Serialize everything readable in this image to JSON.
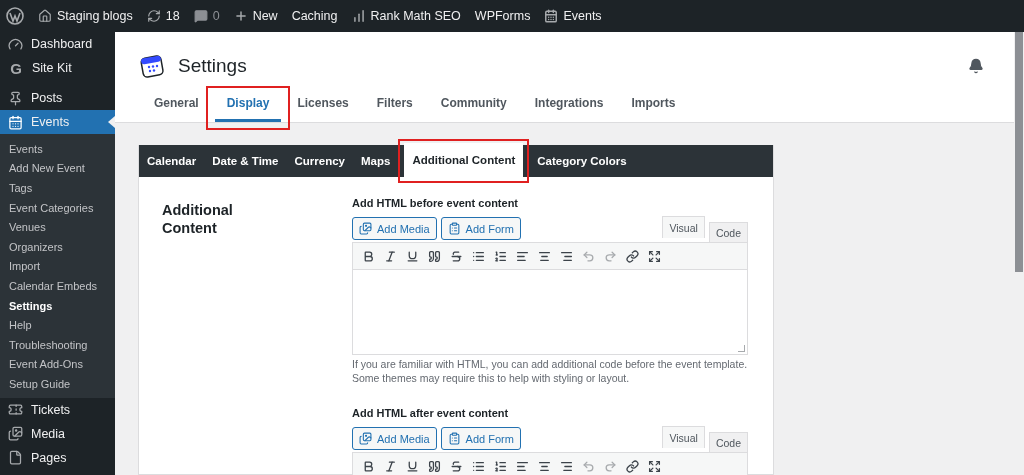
{
  "admin_bar": {
    "site": "Staging blogs",
    "updates": "18",
    "comments": "0",
    "items": [
      {
        "label": "New",
        "kind": "new"
      },
      {
        "label": "Caching",
        "kind": "plain"
      },
      {
        "label": "Rank Math SEO",
        "kind": "chart"
      },
      {
        "label": "WPForms",
        "kind": "plain"
      },
      {
        "label": "Events",
        "kind": "events"
      }
    ]
  },
  "sidebar": {
    "groups": [
      [
        {
          "label": "Dashboard",
          "kind": "gauge",
          "selected": false
        },
        {
          "label": "Site Kit",
          "kind": "glyph",
          "glyph": "G",
          "selected": false
        }
      ],
      [
        {
          "label": "Posts",
          "kind": "pin",
          "selected": false
        },
        {
          "label": "Events",
          "kind": "calendar",
          "selected": true,
          "children": [
            {
              "label": "Events",
              "selected": false
            },
            {
              "label": "Add New Event",
              "selected": false
            },
            {
              "label": "Tags",
              "selected": false
            },
            {
              "label": "Event Categories",
              "selected": false
            },
            {
              "label": "Venues",
              "selected": false
            },
            {
              "label": "Organizers",
              "selected": false
            },
            {
              "label": "Import",
              "selected": false
            },
            {
              "label": "Calendar Embeds",
              "selected": false
            },
            {
              "label": "Settings",
              "selected": true
            },
            {
              "label": "Help",
              "selected": false
            },
            {
              "label": "Troubleshooting",
              "selected": false
            },
            {
              "label": "Event Add-Ons",
              "selected": false
            },
            {
              "label": "Setup Guide",
              "selected": false
            }
          ]
        },
        {
          "label": "Tickets",
          "kind": "ticket",
          "selected": false
        },
        {
          "label": "Media",
          "kind": "media",
          "selected": false
        },
        {
          "label": "Pages",
          "kind": "page",
          "selected": false
        }
      ]
    ]
  },
  "header": {
    "title": "Settings",
    "tabs": [
      {
        "label": "General",
        "selected": false,
        "highlighted": false
      },
      {
        "label": "Display",
        "selected": true,
        "highlighted": true
      },
      {
        "label": "Licenses",
        "selected": false,
        "highlighted": false
      },
      {
        "label": "Filters",
        "selected": false,
        "highlighted": false
      },
      {
        "label": "Community",
        "selected": false,
        "highlighted": false
      },
      {
        "label": "Integrations",
        "selected": false,
        "highlighted": false
      },
      {
        "label": "Imports",
        "selected": false,
        "highlighted": false
      }
    ]
  },
  "panel": {
    "tabs": [
      {
        "label": "Calendar",
        "selected": false,
        "highlighted": false
      },
      {
        "label": "Date & Time",
        "selected": false,
        "highlighted": false
      },
      {
        "label": "Currency",
        "selected": false,
        "highlighted": false
      },
      {
        "label": "Maps",
        "selected": false,
        "highlighted": false
      },
      {
        "label": "Additional Content",
        "selected": true,
        "highlighted": true
      },
      {
        "label": "Category Colors",
        "selected": false,
        "highlighted": false
      }
    ],
    "section_title": "Additional Content",
    "editors": [
      {
        "label": "Add HTML before event content",
        "buttons": [
          {
            "label": "Add Media",
            "kind": "media"
          },
          {
            "label": "Add Form",
            "kind": "form"
          }
        ],
        "modes": [
          {
            "label": "Visual",
            "selected": false
          },
          {
            "label": "Code",
            "selected": true
          }
        ],
        "toolbar": [
          {
            "kind": "bold",
            "disabled": false
          },
          {
            "kind": "italic",
            "disabled": false
          },
          {
            "kind": "underline",
            "disabled": false
          },
          {
            "kind": "quote",
            "disabled": false
          },
          {
            "kind": "strike",
            "disabled": false
          },
          {
            "kind": "bullets",
            "disabled": false
          },
          {
            "kind": "numbers",
            "disabled": false
          },
          {
            "kind": "align-left",
            "disabled": false
          },
          {
            "kind": "align-center",
            "disabled": false
          },
          {
            "kind": "align-right",
            "disabled": false
          },
          {
            "kind": "undo",
            "disabled": true
          },
          {
            "kind": "redo",
            "disabled": true
          },
          {
            "kind": "link",
            "disabled": false
          },
          {
            "kind": "fullscreen",
            "disabled": false
          }
        ],
        "description": "If you are familiar with HTML, you can add additional code before the event template. Some themes may require this to help with styling or layout."
      },
      {
        "label": "Add HTML after event content",
        "buttons": [
          {
            "label": "Add Media",
            "kind": "media"
          },
          {
            "label": "Add Form",
            "kind": "form"
          }
        ],
        "modes": [
          {
            "label": "Visual",
            "selected": false
          },
          {
            "label": "Code",
            "selected": true
          }
        ],
        "toolbar": [
          {
            "kind": "bold",
            "disabled": false
          },
          {
            "kind": "italic",
            "disabled": false
          },
          {
            "kind": "underline",
            "disabled": false
          },
          {
            "kind": "quote",
            "disabled": false
          },
          {
            "kind": "strike",
            "disabled": false
          },
          {
            "kind": "bullets",
            "disabled": false
          },
          {
            "kind": "numbers",
            "disabled": false
          },
          {
            "kind": "align-left",
            "disabled": false
          },
          {
            "kind": "align-center",
            "disabled": false
          },
          {
            "kind": "align-right",
            "disabled": false
          },
          {
            "kind": "undo",
            "disabled": true
          },
          {
            "kind": "redo",
            "disabled": true
          },
          {
            "kind": "link",
            "disabled": false
          },
          {
            "kind": "fullscreen",
            "disabled": false
          }
        ]
      }
    ]
  }
}
